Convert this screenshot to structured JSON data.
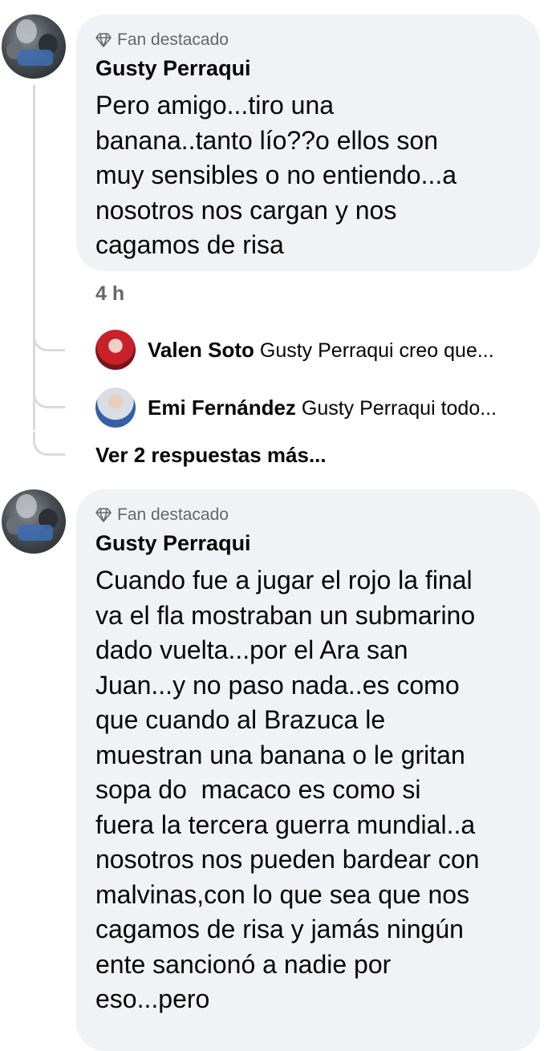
{
  "comments": [
    {
      "badge": "Fan destacado",
      "author": "Gusty Perraqui",
      "text": "Pero amigo...tiro una\nbanana..tanto lío??o ellos son\nmuy sensibles o no entiendo...a\nnosotros nos cargan y nos\ncagamos de risa",
      "time": "4 h",
      "replies": [
        {
          "name": "Valen Soto",
          "preview": "Gusty Perraqui  creo que..."
        },
        {
          "name": "Emi Fernández",
          "preview": "Gusty Perraqui todo..."
        }
      ],
      "more_replies": "Ver 2 respuestas más..."
    },
    {
      "badge": "Fan destacado",
      "author": "Gusty Perraqui",
      "text": "Cuando fue a jugar el rojo la final\nva el fla mostraban un submarino\ndado vuelta...por el Ara san\nJuan...y no paso nada..es como\nque cuando al Brazuca le\nmuestran una banana o le gritan\nsopa do  macaco es como si\nfuera la tercera guerra mundial..a\nnosotros nos pueden bardear con\nmalvinas,con lo que sea que nos\ncagamos de risa y jamás ningún\nente sancionó a nadie por\neso...pero"
    }
  ],
  "icons": {
    "badge": "diamond-icon"
  },
  "colors": {
    "bubble": "#f0f2f5",
    "secondary_text": "#65676b",
    "thread_line": "#d8dadf"
  }
}
